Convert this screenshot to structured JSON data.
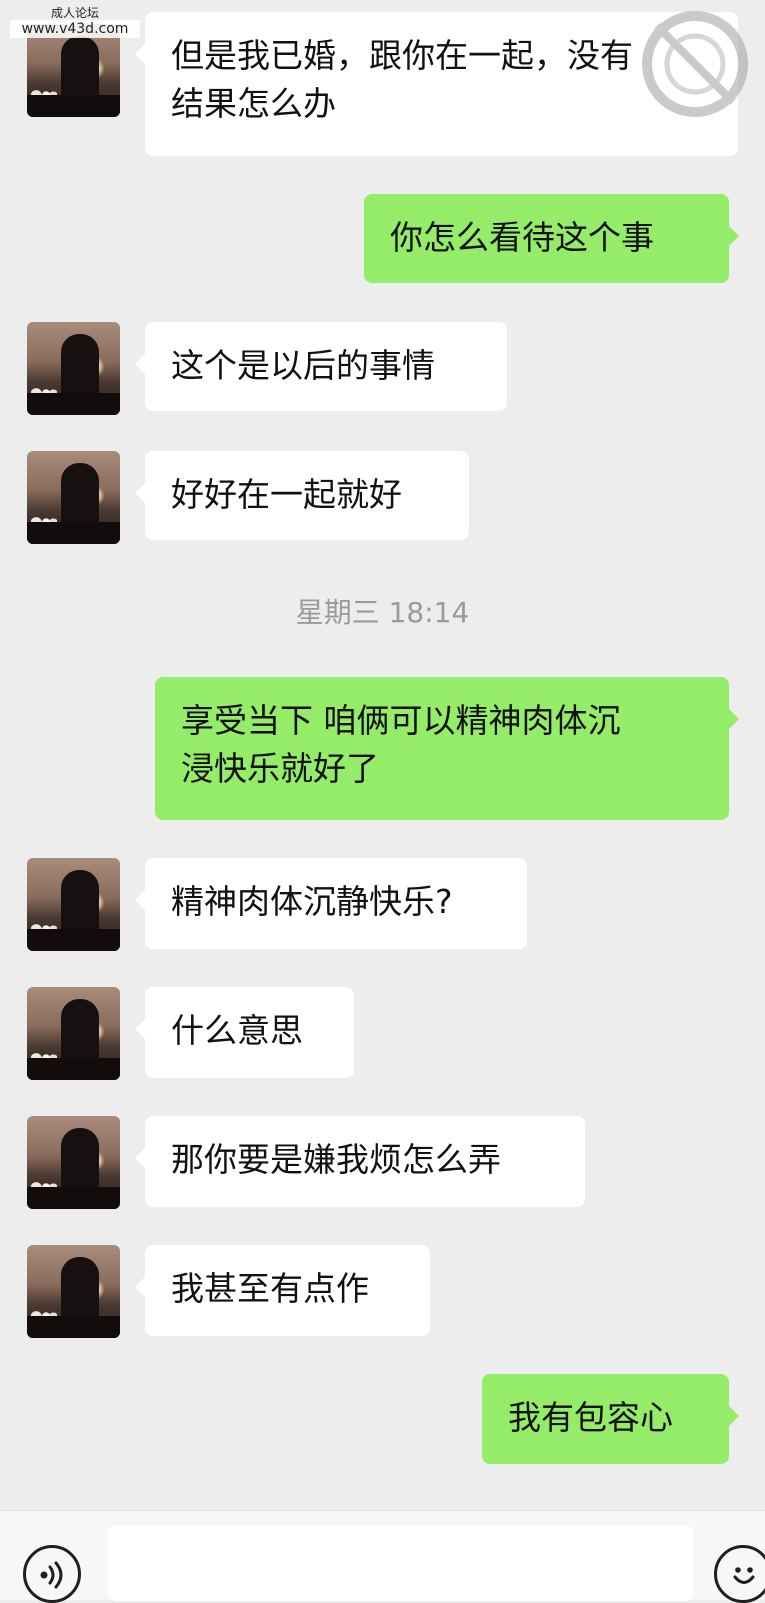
{
  "watermarks": {
    "top_left_label": "成人论坛",
    "top_left_url": "www.v43d.com",
    "top_right_icon": "circular-watermark-icon"
  },
  "conversation": {
    "timestamp": "星期三 18:14",
    "messages": [
      {
        "side": "left",
        "text_lines": [
          "但是我已婚，跟你在一起，没有",
          "结果怎么办"
        ]
      },
      {
        "side": "right",
        "text_lines": [
          "你怎么看待这个事"
        ]
      },
      {
        "side": "left",
        "text_lines": [
          "这个是以后的事情"
        ]
      },
      {
        "side": "left",
        "text_lines": [
          "好好在一起就好"
        ]
      },
      {
        "side": "right",
        "text_lines": [
          "享受当下  咱俩可以精神肉体沉",
          "浸快乐就好了"
        ]
      },
      {
        "side": "left",
        "text_lines": [
          "精神肉体沉静快乐?"
        ]
      },
      {
        "side": "left",
        "text_lines": [
          "什么意思"
        ]
      },
      {
        "side": "left",
        "text_lines": [
          "那你要是嫌我烦怎么弄"
        ]
      },
      {
        "side": "left",
        "text_lines": [
          "我甚至有点作"
        ]
      },
      {
        "side": "right",
        "text_lines": [
          "我有包容心"
        ]
      }
    ]
  },
  "input_bar": {
    "voice_icon": "voice-icon",
    "emoji_icon": "emoji-icon"
  },
  "colors": {
    "chat_background": "#ededed",
    "left_bubble": "#ffffff",
    "right_bubble": "#95ec69",
    "timestamp_text": "#9a9a9a"
  }
}
